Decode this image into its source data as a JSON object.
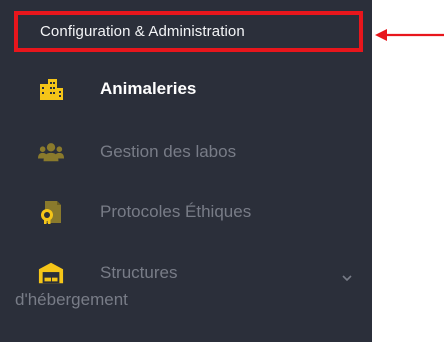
{
  "header": {
    "title": "Configuration & Administration"
  },
  "menu": [
    {
      "label": "Animaleries",
      "icon": "building-icon",
      "active": true
    },
    {
      "label": "Gestion des labos",
      "icon": "users-group-icon",
      "active": false
    },
    {
      "label": "Protocoles Éthiques",
      "icon": "certificate-document-icon",
      "active": false
    },
    {
      "label": "Structures",
      "label_continued": "d'hébergement",
      "icon": "warehouse-icon",
      "active": false,
      "expandable": true
    }
  ],
  "colors": {
    "sidebar_bg": "#2b2f3a",
    "highlight_border": "#e8161c",
    "active_icon": "#f5c518",
    "inactive_icon": "#8a7a2c",
    "annotation_arrow": "#e8161c"
  }
}
